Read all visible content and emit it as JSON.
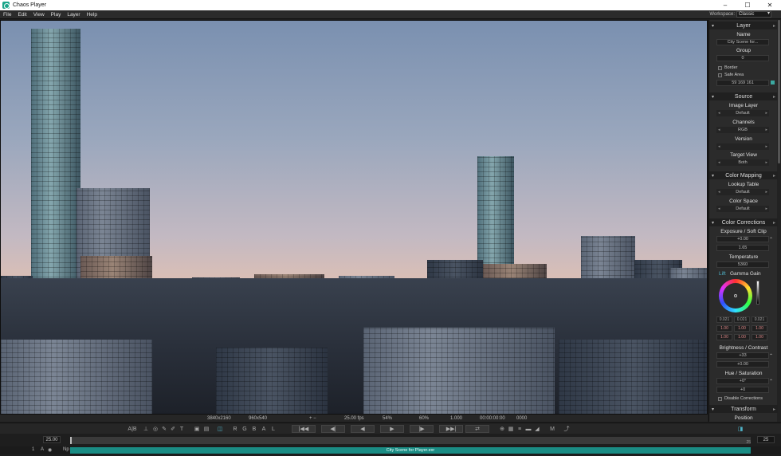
{
  "app": {
    "title": "Chaos Player"
  },
  "window_buttons": {
    "minimize": "–",
    "maximize": "☐",
    "close": "✕"
  },
  "menu": [
    "File",
    "Edit",
    "View",
    "Play",
    "Layer",
    "Help"
  ],
  "workspace": {
    "label": "Workspace:",
    "value": "Classic"
  },
  "viewer_status": {
    "resolution": "3840x2160",
    "viewport": "960x540",
    "zoom_controls": "+ −",
    "fps": "25.00 fps",
    "zoom1": "54%",
    "zoom2": "60%",
    "ratio": "1.000",
    "timecode": "00:00:00:00",
    "frame": "0000"
  },
  "panel": {
    "layer": {
      "header": "Layer",
      "name_label": "Name",
      "name_value": "City Scene for...",
      "group_label": "Group",
      "group_value": "0",
      "border_label": "Border",
      "safe_area_label": "Safe Area",
      "color_value": "59 169 161"
    },
    "source": {
      "header": "Source",
      "image_layer_label": "Image Layer",
      "image_layer_value": "Default",
      "channels_label": "Channels",
      "channels_value": "RGB",
      "version_label": "Version",
      "version_value": "",
      "target_view_label": "Target View",
      "target_view_value": "Both"
    },
    "color_mapping": {
      "header": "Color Mapping",
      "lut_label": "Lookup Table",
      "lut_value": "Default",
      "color_space_label": "Color Space",
      "color_space_value": "Default"
    },
    "color_corrections": {
      "header": "Color Corrections",
      "exposure_label": "Exposure / Soft Clip",
      "exposure_value": "+0.00",
      "soft_clip_value": "1.65",
      "temperature_label": "Temperature",
      "temperature_value": "5360",
      "lift_label": "Lift",
      "gamma_gain_label": "Gamma Gain",
      "lift_values": [
        "0.021",
        "0.021",
        "0.021"
      ],
      "gamma_values": [
        "1.00",
        "1.00",
        "1.00"
      ],
      "gain_values": [
        "1.00",
        "1.00",
        "1.00"
      ],
      "bc_label": "Brightness / Contrast",
      "brightness_value": "+33",
      "contrast_value": "+0.00",
      "hs_label": "Hue / Saturation",
      "hue_value": "+0°",
      "saturation_value": "+0",
      "disable_label": "Disable Corrections"
    },
    "transform": {
      "header": "Transform",
      "position_label": "Position"
    }
  },
  "transport": {
    "ab": "A|B",
    "channels": [
      "R",
      "G",
      "B",
      "A",
      "L"
    ],
    "m_label": "M"
  },
  "timeline": {
    "fps_value": "25.00",
    "end_value": "25",
    "scrub_end": "25",
    "layer_index": "1",
    "layer_a": "A",
    "layer_np": "Np",
    "clip_label": "City Scene for Player.exr"
  },
  "colors": {
    "accent": "#1a8c84",
    "layer_color": "#3ba9a1"
  }
}
